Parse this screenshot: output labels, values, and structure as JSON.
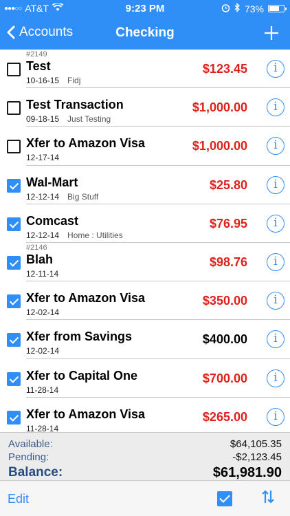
{
  "status": {
    "carrier": "AT&T",
    "time": "9:23 PM",
    "battery": "73%",
    "battery_level": 0.73
  },
  "nav": {
    "back_label": "Accounts",
    "title": "Checking"
  },
  "transactions": [
    {
      "num": "#2149",
      "payee": "Test",
      "date": "10-16-15",
      "memo": "Fidj",
      "amount": "$123.45",
      "negative": true,
      "cleared": false
    },
    {
      "num": "",
      "payee": "Test Transaction",
      "date": "09-18-15",
      "memo": "Just Testing",
      "amount": "$1,000.00",
      "negative": true,
      "cleared": false
    },
    {
      "num": "",
      "payee": "Xfer to Amazon Visa",
      "date": "12-17-14",
      "memo": "",
      "amount": "$1,000.00",
      "negative": true,
      "cleared": false
    },
    {
      "num": "",
      "payee": "Wal-Mart",
      "date": "12-12-14",
      "memo": "Big Stuff",
      "amount": "$25.80",
      "negative": true,
      "cleared": true
    },
    {
      "num": "",
      "payee": "Comcast",
      "date": "12-12-14",
      "memo": "Home : Utilities",
      "amount": "$76.95",
      "negative": true,
      "cleared": true
    },
    {
      "num": "#2146",
      "payee": "Blah",
      "date": "12-11-14",
      "memo": "",
      "amount": "$98.76",
      "negative": true,
      "cleared": true
    },
    {
      "num": "",
      "payee": "Xfer to Amazon Visa",
      "date": "12-02-14",
      "memo": "",
      "amount": "$350.00",
      "negative": true,
      "cleared": true
    },
    {
      "num": "",
      "payee": "Xfer from Savings",
      "date": "12-02-14",
      "memo": "",
      "amount": "$400.00",
      "negative": false,
      "cleared": true
    },
    {
      "num": "",
      "payee": "Xfer to Capital One",
      "date": "11-28-14",
      "memo": "",
      "amount": "$700.00",
      "negative": true,
      "cleared": true
    },
    {
      "num": "",
      "payee": "Xfer to Amazon Visa",
      "date": "11-28-14",
      "memo": "",
      "amount": "$265.00",
      "negative": true,
      "cleared": true
    }
  ],
  "summary": {
    "available_label": "Available:",
    "available": "$64,105.35",
    "pending_label": "Pending:",
    "pending": "-$2,123.45",
    "balance_label": "Balance:",
    "balance": "$61,981.90"
  },
  "toolbar": {
    "edit_label": "Edit"
  },
  "colors": {
    "accent": "#2f8ff7",
    "negative": "#e0211b"
  }
}
